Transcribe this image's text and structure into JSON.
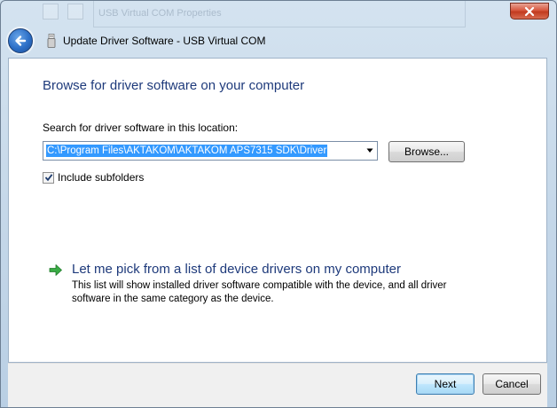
{
  "window": {
    "title": "Update Driver Software - USB Virtual COM",
    "background_title": "USB Virtual COM Properties"
  },
  "content": {
    "heading": "Browse for driver software on your computer",
    "search_label": "Search for driver software in this location:",
    "path_value": "C:\\Program Files\\AKTAKOM\\AKTAKOM APS7315 SDK\\Driver",
    "browse_label": "Browse...",
    "include_subfolders_label": "Include subfolders",
    "include_subfolders_checked": true,
    "pick_title": "Let me pick from a list of device drivers on my computer",
    "pick_description": "This list will show installed driver software compatible with the device, and all driver software in the same category as the device."
  },
  "footer": {
    "next_label": "Next",
    "cancel_label": "Cancel"
  },
  "colors": {
    "heading": "#1e3a7b",
    "selection": "#3399ff",
    "arrow_green": "#2e9e3a"
  },
  "icons": {
    "back": "back-arrow-icon",
    "device": "usb-device-icon",
    "close": "close-icon",
    "pick": "green-arrow-icon",
    "dropdown": "chevron-down-icon",
    "check": "checkmark-icon"
  }
}
